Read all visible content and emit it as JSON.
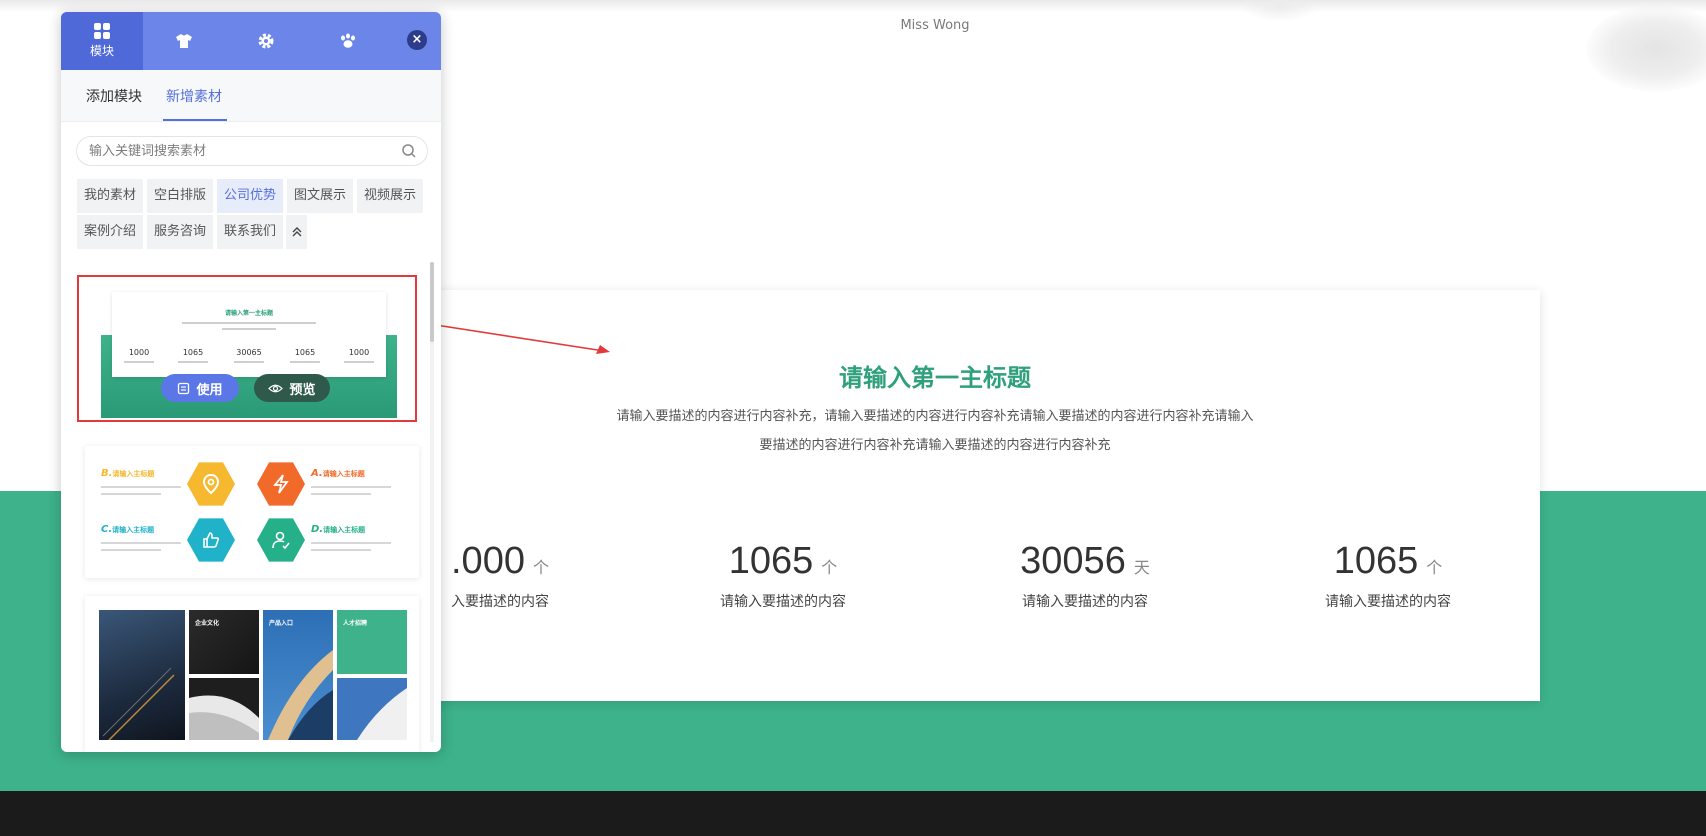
{
  "page": {
    "author": "Miss Wong",
    "main_title": "请输入第一主标题",
    "main_desc_line1": "请输入要描述的内容进行内容补充，请输入要描述的内容进行内容补充请输入要描述的内容进行内容补充请输入",
    "main_desc_line2": "要描述的内容进行内容补充请输入要描述的内容进行内容补充",
    "stats": [
      {
        "num": ".000",
        "unit": "个",
        "desc": "入要描述的内容"
      },
      {
        "num": "1065",
        "unit": "个",
        "desc": "请输入要描述的内容"
      },
      {
        "num": "30056",
        "unit": "天",
        "desc": "请输入要描述的内容"
      },
      {
        "num": "1065",
        "unit": "个",
        "desc": "请输入要描述的内容"
      }
    ],
    "colors": {
      "brand_green": "#3db28b",
      "title_green": "#2ea07c",
      "footer": "#1b1b1b",
      "arrow_red": "#e23a3a"
    }
  },
  "panel": {
    "tabs": [
      {
        "label": "模块",
        "icon": "grid-icon"
      },
      {
        "label": "",
        "icon": "shirt-icon"
      },
      {
        "label": "",
        "icon": "gear-icon"
      },
      {
        "label": "",
        "icon": "paw-icon"
      }
    ],
    "close_icon": "×",
    "sub_tabs": [
      "添加模块",
      "新增素材"
    ],
    "search_placeholder": "输入关键词搜索素材",
    "categories": [
      "我的素材",
      "空白排版",
      "公司优势",
      "图文展示",
      "视频展示",
      "案例介绍",
      "服务咨询",
      "联系我们"
    ],
    "active_category": "公司优势",
    "accent": "#5570dd",
    "template1": {
      "title": "请输入第一主标题",
      "stats": [
        "1000",
        "1065",
        "30065",
        "1065",
        "1000"
      ],
      "use_label": "使用",
      "preview_label": "预览"
    },
    "template2": {
      "items": [
        {
          "letter": "B.",
          "title": "请输入主标题",
          "color": "#f5b82e"
        },
        {
          "letter": "A.",
          "title": "请输入主标题",
          "color": "#f26a2a"
        },
        {
          "letter": "C.",
          "title": "请输入主标题",
          "color": "#1fb2c9"
        },
        {
          "letter": "D.",
          "title": "请输入主标题",
          "color": "#26b08a"
        }
      ]
    },
    "template3": {
      "tiles": [
        "企业文化",
        "产品入口",
        "人才招聘"
      ]
    }
  }
}
